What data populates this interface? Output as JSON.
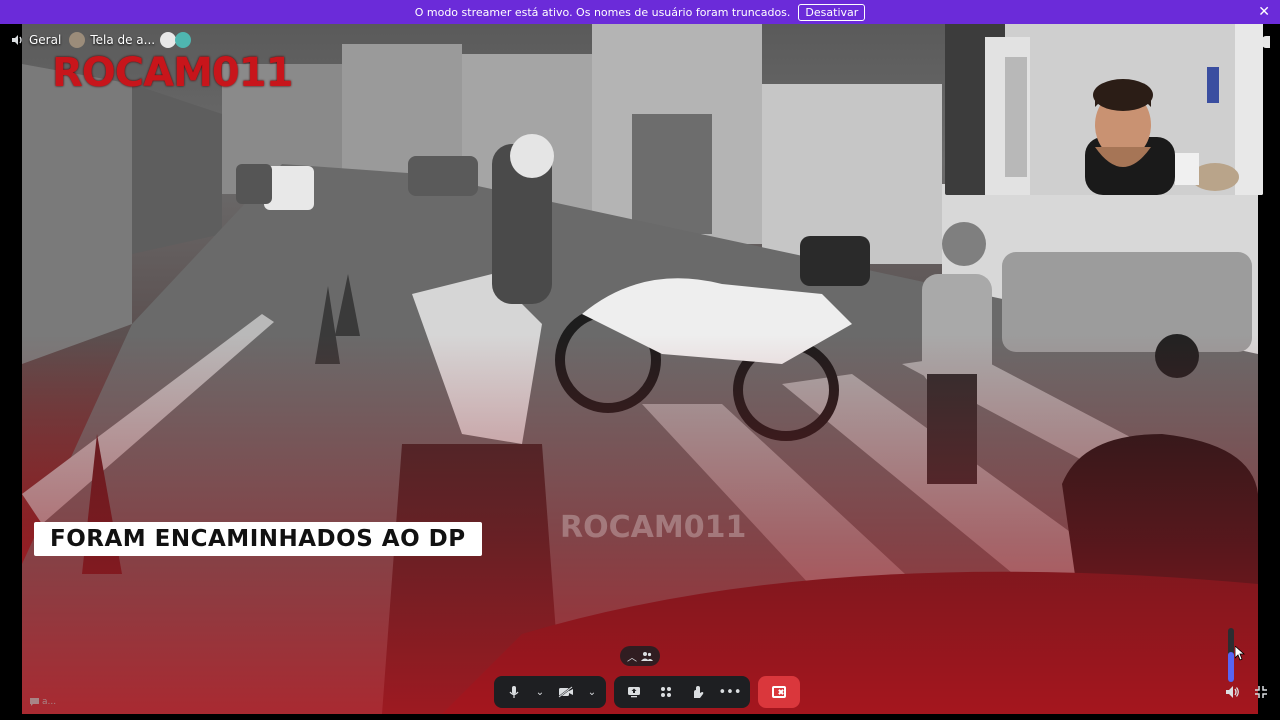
{
  "banner": {
    "message": "O modo streamer está ativo. Os nomes de usuário foram truncados.",
    "button_label": "Desativar",
    "close_label": "✕",
    "color": "#6b2bd9"
  },
  "voice": {
    "channel_name": "Geral",
    "streamer_name": "Tela de a..."
  },
  "stream": {
    "logo_text": "ROCAM011",
    "logo_sub": "",
    "caption": "FORAM ENCAMINHADOS AO DP",
    "watermark": "ROCAM011",
    "accent_red": "#c8151b"
  },
  "chat_chip": {
    "label": "a..."
  },
  "controls": {
    "end_color": "#da373c",
    "volume_level": 0.55
  }
}
